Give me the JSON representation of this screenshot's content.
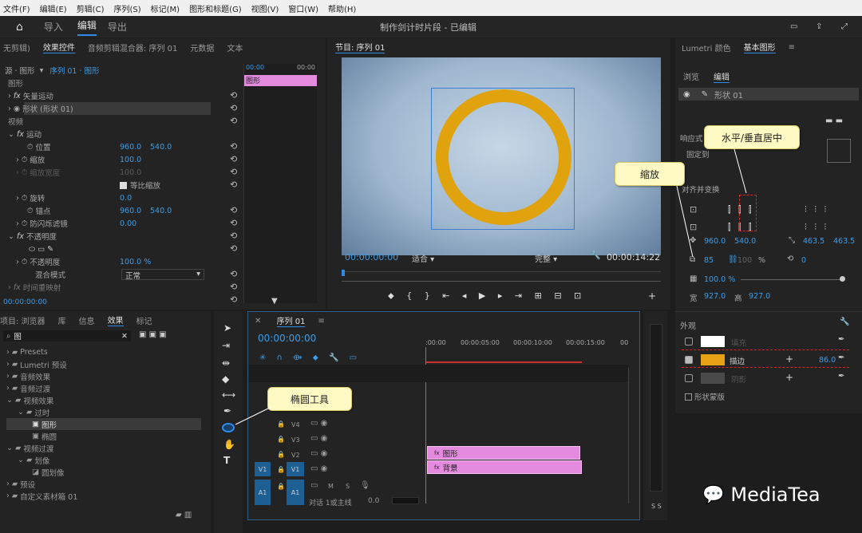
{
  "menu": [
    "文件(F)",
    "编辑(E)",
    "剪辑(C)",
    "序列(S)",
    "标记(M)",
    "图形和标题(G)",
    "视图(V)",
    "窗口(W)",
    "帮助(H)"
  ],
  "workspace": {
    "tabs": [
      "导入",
      "编辑",
      "导出"
    ],
    "title": "制作剑计时片段 - 已编辑"
  },
  "effects_panel": {
    "tabs": [
      "无剪辑)",
      "效果控件",
      "音频剪辑混合器: 序列 01",
      "元数据",
      "文本"
    ],
    "source": "源 · 图形",
    "sequence": "序列 01 · 图形",
    "time_start": "00:00",
    "time_end": "00:00",
    "clip_name": "图形",
    "rows": [
      {
        "label": "图形",
        "kind": "section"
      },
      {
        "label": "矢量运动",
        "kind": "fx"
      },
      {
        "label": "形状 (形状 01)",
        "kind": "item"
      },
      {
        "label": "视频",
        "kind": "section"
      },
      {
        "label": "运动",
        "kind": "fx"
      },
      {
        "label": "位置",
        "v1": "960.0",
        "v2": "540.0"
      },
      {
        "label": "缩放",
        "v1": "100.0"
      },
      {
        "label": "缩放宽度",
        "v1": "100.0"
      },
      {
        "label": "等比缩放",
        "kind": "check"
      },
      {
        "label": "旋转",
        "v1": "0.0"
      },
      {
        "label": "锚点",
        "v1": "960.0",
        "v2": "540.0"
      },
      {
        "label": "防闪烁滤镜",
        "v1": "0.00"
      },
      {
        "label": "不透明度",
        "kind": "fx"
      },
      {
        "label": "",
        "kind": "shapes"
      },
      {
        "label": "不透明度",
        "v1": "100.0 %"
      },
      {
        "label": "混合模式",
        "v1": "正常",
        "kind": "select"
      },
      {
        "label": "时间重映射",
        "kind": "fx"
      }
    ],
    "timecode": "00:00:00:00"
  },
  "program": {
    "title": "节目: 序列 01",
    "timecode": "00:00:00:00",
    "fit": "适合",
    "quality": "完整",
    "duration": "00:00:14:22"
  },
  "right_panel": {
    "tabs": [
      "Lumetri 颜色",
      "基本图形"
    ],
    "subtabs": [
      "浏览",
      "编辑"
    ],
    "layer": "形状 01",
    "responsive_label": "响应式",
    "fixed_label": "固定到",
    "align_label": "对齐并变换",
    "pos_x": "960.0",
    "pos_y": "540.0",
    "anchor_x": "463.5",
    "anchor_y": "463.5",
    "scale": "85",
    "scale_pct": "100",
    "pct": "%",
    "rotation": "0",
    "opacity": "100.0 %",
    "width_label": "宽",
    "width": "927.0",
    "height_label": "高",
    "height": "927.0",
    "appearance": "外观",
    "fill_label": "填充",
    "stroke_label": "描边",
    "stroke_value": "86.0",
    "shadow_label": "阴影",
    "mask_label": "形状蒙版",
    "fill_color": "#ffffff",
    "stroke_color": "#e6a214",
    "shadow_color": "#4a4a4a"
  },
  "project": {
    "tabs": [
      "项目: 浏览器",
      "库",
      "信息",
      "效果",
      "标记"
    ],
    "search": "图",
    "items": [
      "Presets",
      "Lumetri 预设",
      "音频效果",
      "音频过渡",
      "视频效果",
      "过时",
      "图形",
      "椭圆",
      "视频过渡",
      "划像",
      "圆划像",
      "预设",
      "自定义素材箱 01"
    ]
  },
  "timeline": {
    "title": "序列 01",
    "timecode": "00:00:00:00",
    "ruler": [
      ":00:00",
      "00:00:05:00",
      "00:00:10:00",
      "00:00:15:00",
      "00"
    ],
    "tracks": [
      "V4",
      "V3",
      "V2",
      "V1",
      "A1"
    ],
    "clip_v2": "图形",
    "clip_v1": "背景",
    "audio_label": "对话 1或主线",
    "audio_value": "0.0",
    "m_label": "M",
    "s_label": "S"
  },
  "callouts": {
    "align": "水平/垂直居中",
    "scale": "缩放",
    "ellipse": "椭圆工具"
  },
  "watermark": "MediaTea",
  "colors": {
    "ring": "#e0a30d",
    "accent": "#2d8ceb",
    "clip": "#e48adf"
  }
}
